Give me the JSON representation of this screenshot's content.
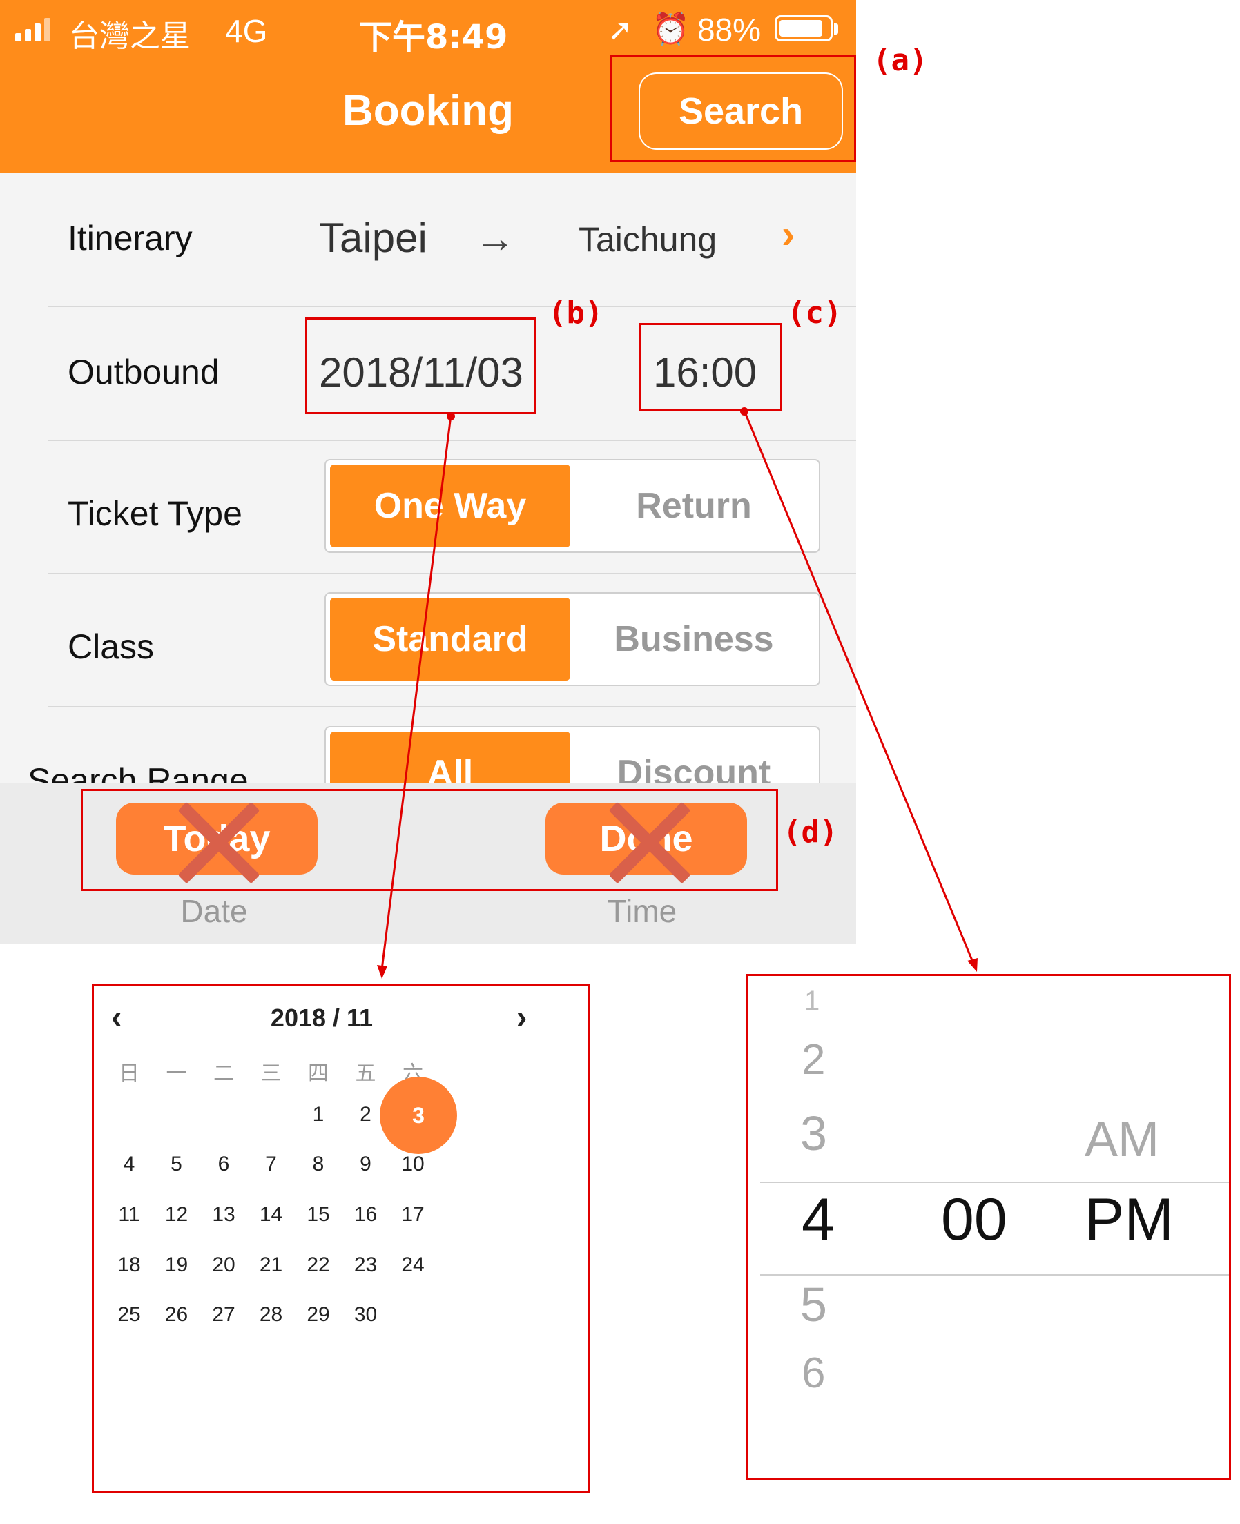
{
  "status_bar": {
    "carrier": "台灣之星",
    "network": "4G",
    "time": "下午8:49",
    "battery_pct": "88%",
    "battery_level": 0.88
  },
  "header": {
    "title": "Booking",
    "search_label": "Search"
  },
  "itinerary": {
    "label": "Itinerary",
    "from": "Taipei",
    "arrow": "→",
    "to": "Taichung",
    "chevron": "›"
  },
  "outbound": {
    "label": "Outbound",
    "date": "2018/11/03",
    "time": "16:00"
  },
  "ticket_type": {
    "label": "Ticket Type",
    "options": [
      "One Way",
      "Return"
    ],
    "selected": "One Way"
  },
  "class": {
    "label": "Class",
    "options": [
      "Standard",
      "Business"
    ],
    "selected": "Standard"
  },
  "search_range": {
    "label": "Search Range",
    "options": [
      "All",
      "Discount"
    ],
    "selected": "All"
  },
  "toolbar": {
    "today_label": "Today",
    "done_label": "Done",
    "date_label": "Date",
    "time_label": "Time"
  },
  "annotations": {
    "a": "(a)",
    "b": "(b)",
    "c": "(c)",
    "d": "(d)"
  },
  "calendar": {
    "title": "2018 / 11",
    "prev": "‹",
    "next": "›",
    "weekdays": [
      "日",
      "一",
      "二",
      "三",
      "四",
      "五",
      "六"
    ],
    "first_weekday_index": 4,
    "days_in_month": 30,
    "selected_day": 3
  },
  "time_picker": {
    "hours_above": [
      "1",
      "2",
      "3"
    ],
    "hour_selected": "4",
    "hours_below": [
      "5",
      "6"
    ],
    "minute_selected": "00",
    "ampm_above": "AM",
    "ampm_selected": "PM"
  },
  "colors": {
    "brand_orange": "#ff8c1a",
    "button_orange": "#ff8034",
    "annotation_red": "#e00000"
  }
}
